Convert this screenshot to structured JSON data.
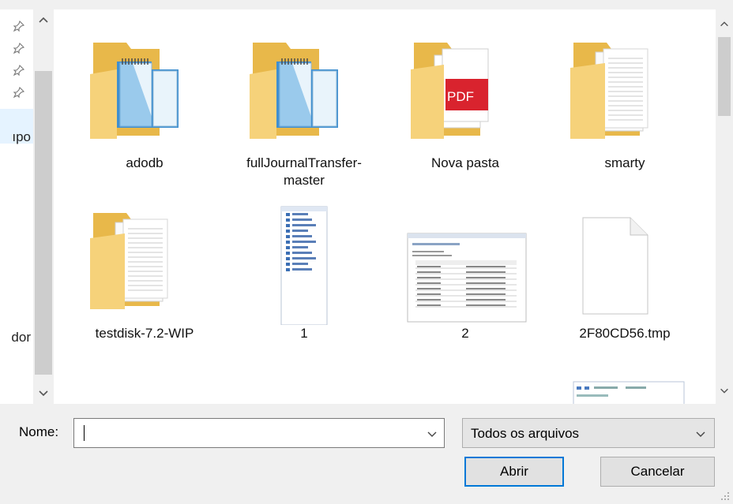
{
  "nav": {
    "rows": [
      {
        "text": ""
      },
      {
        "text": ""
      },
      {
        "text": ""
      },
      {
        "text": ""
      },
      {
        "text": ""
      },
      {
        "text": "ıpo"
      },
      {
        "text": ""
      },
      {
        "text": ""
      },
      {
        "text": ""
      },
      {
        "text": ""
      },
      {
        "text": ""
      },
      {
        "text": ""
      },
      {
        "text": ""
      },
      {
        "text": "dor"
      }
    ]
  },
  "files": [
    {
      "name": "adodb",
      "kind": "folder-notepad"
    },
    {
      "name": "fullJournalTransfer-master",
      "kind": "folder-notepad"
    },
    {
      "name": "Nova pasta",
      "kind": "folder-pdf"
    },
    {
      "name": "smarty",
      "kind": "folder-docs"
    },
    {
      "name": "testdisk-7.2-WIP",
      "kind": "folder-docs"
    },
    {
      "name": "1",
      "kind": "image-list"
    },
    {
      "name": "2",
      "kind": "image-table"
    },
    {
      "name": "2F80CD56.tmp",
      "kind": "blank-file"
    },
    {
      "name": "",
      "kind": "image-toolbar"
    }
  ],
  "bottom": {
    "name_label": "Nome:",
    "name_value": "",
    "file_type": "Todos os arquivos",
    "open_label": "Abrir",
    "cancel_label": "Cancelar"
  },
  "colors": {
    "folder": "#f6d27a",
    "folder_dark": "#e8b84a",
    "pdf_red": "#d9232e",
    "selection": "#cce8ff",
    "accent": "#0078d7"
  }
}
